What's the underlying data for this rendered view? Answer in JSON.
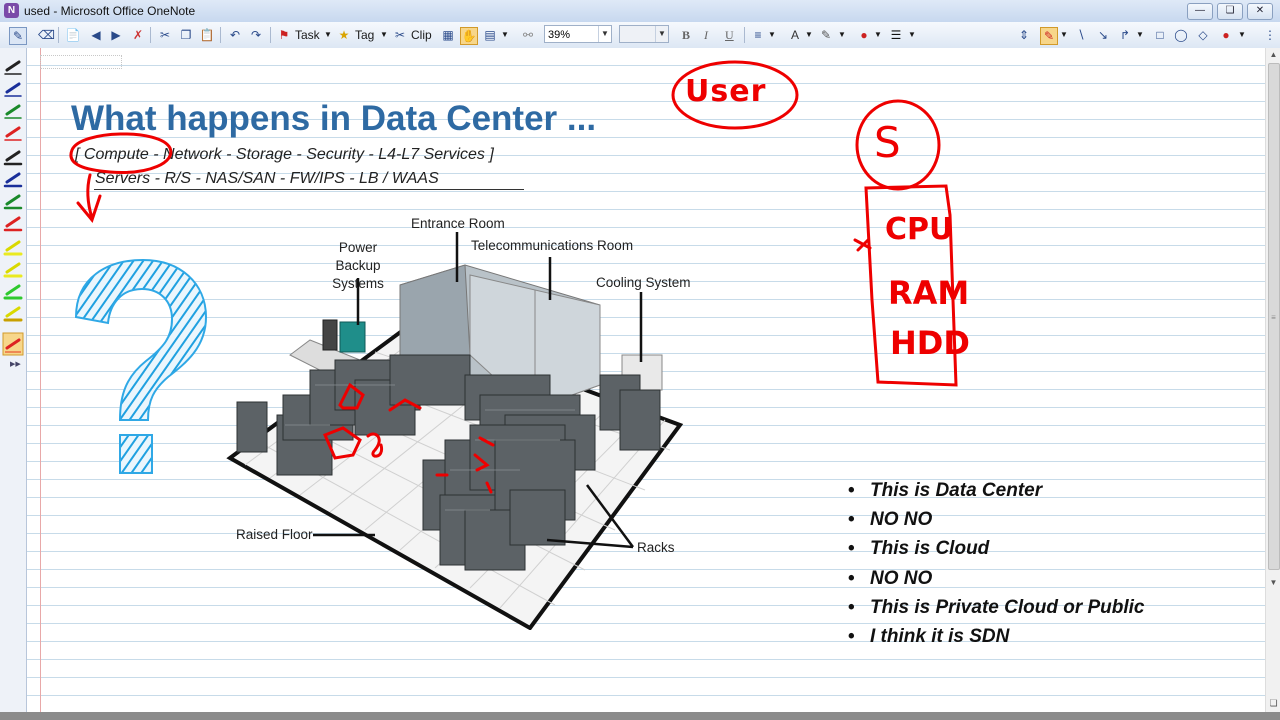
{
  "window": {
    "title": "used - Microsoft Office OneNote",
    "controls": [
      "minimize",
      "restore",
      "close"
    ]
  },
  "toolbar": {
    "task_label": "Task",
    "tag_label": "Tag",
    "clip_label": "Clip",
    "zoom_value": "39%",
    "font_size_value": "",
    "bold": "B",
    "italic": "I",
    "underline": "U"
  },
  "page": {
    "heading": "What happens in Data Center ...",
    "line1": "[ Compute - Network - Storage - Security   - L4-L7 Services ]",
    "line2": "Servers  -    R/S     -  NAS/SAN  -  FW/IPS  -    LB / WAAS",
    "bullets": [
      "This is Data Center",
      "NO NO",
      "This is Cloud",
      "NO NO",
      "This is Private Cloud or Public",
      "I think it is SDN"
    ]
  },
  "diagram": {
    "labels": {
      "entrance_room": "Entrance Room",
      "telecom_room": "Telecommunications Room",
      "power_backup": "Power Backup\nSystems",
      "cooling": "Cooling System",
      "raised_floor": "Raised Floor",
      "racks": "Racks"
    }
  },
  "handwriting": {
    "user": "User",
    "server_letter": "S",
    "cpu": "CPU",
    "ram": "RAM",
    "hdd": "HDD"
  },
  "colors": {
    "heading": "#2e6aa3",
    "ink": "#e00000",
    "rule_lines": "#c7dbe9"
  }
}
